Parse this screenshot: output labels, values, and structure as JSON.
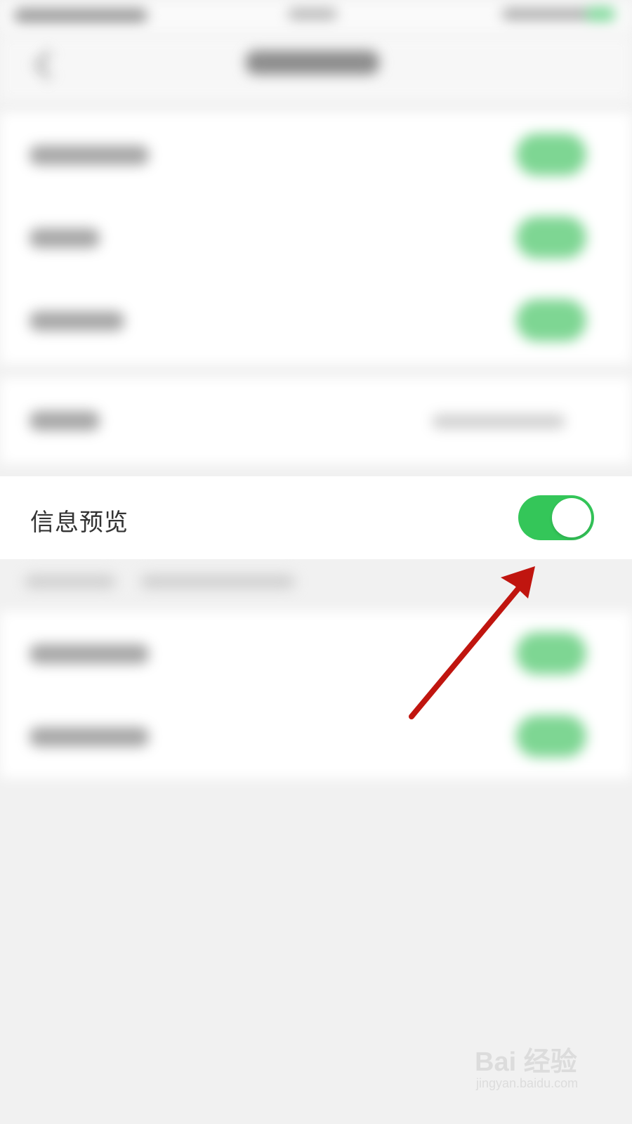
{
  "focused_setting": {
    "label": "信息预览",
    "enabled": true
  },
  "colors": {
    "toggle_on": "#34c659",
    "arrow": "#c0150f",
    "background": "#f1f1f1"
  },
  "watermark": {
    "logo": "Bai 经验",
    "url": "jingyan.baidu.com"
  }
}
